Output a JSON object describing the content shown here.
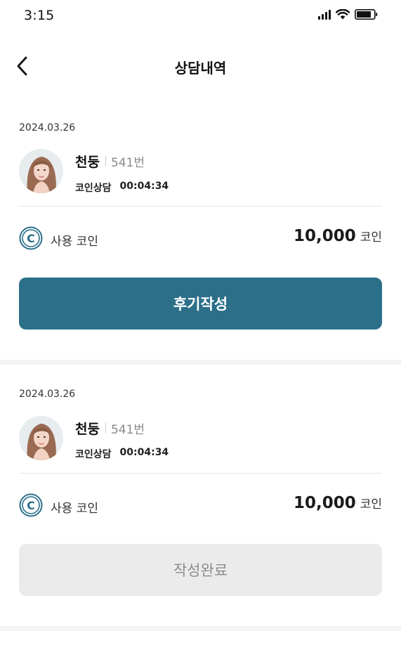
{
  "status_bar": {
    "time": "3:15",
    "icons": [
      "signal-icon",
      "wifi-icon",
      "battery-icon"
    ]
  },
  "nav": {
    "title": "상담내역",
    "back_icon": "chevron-left-icon"
  },
  "history": [
    {
      "date": "2024.03.26",
      "counselor_name": "천둥",
      "counselor_id": "541번",
      "session_type": "코인상담",
      "duration": "00:04:34",
      "coin_label": "사용 코인",
      "coin_value": "10,000",
      "coin_unit": "코인",
      "action_label": "후기작성",
      "action_state": "active"
    },
    {
      "date": "2024.03.26",
      "counselor_name": "천둥",
      "counselor_id": "541번",
      "session_type": "코인상담",
      "duration": "00:04:34",
      "coin_label": "사용 코인",
      "coin_value": "10,000",
      "coin_unit": "코인",
      "action_label": "작성완료",
      "action_state": "disabled"
    }
  ],
  "colors": {
    "primary": "#2b6f89",
    "disabled_bg": "#ebebeb",
    "disabled_text": "#8c8c8c",
    "coin_ring": "#2b6f89"
  }
}
